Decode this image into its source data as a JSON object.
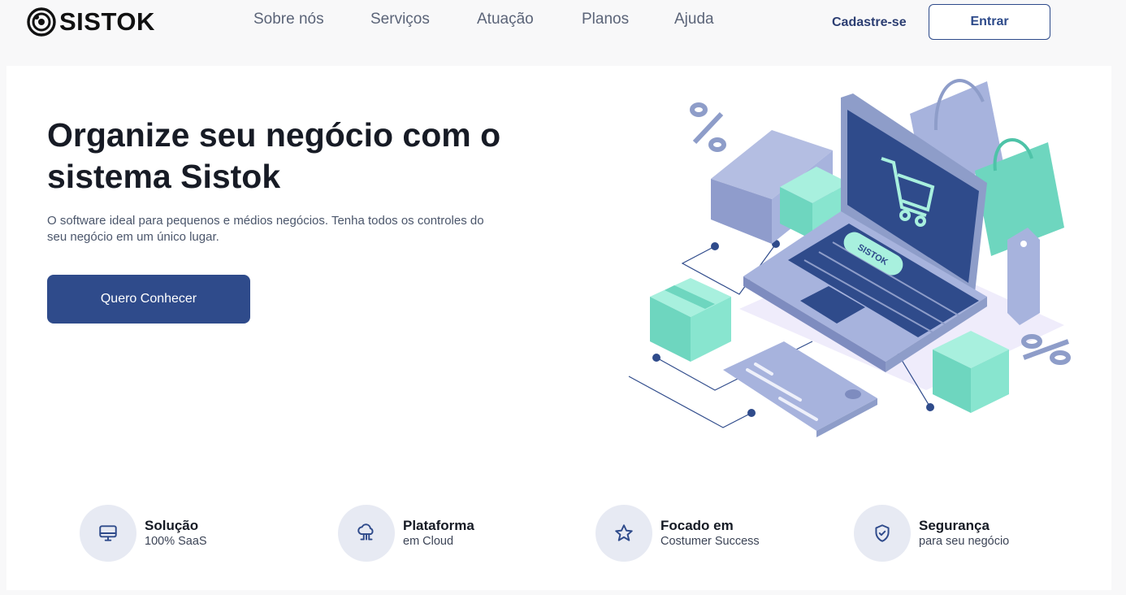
{
  "brand": {
    "name": "SISTOK"
  },
  "nav": {
    "items": [
      {
        "label": "Sobre nós"
      },
      {
        "label": "Serviços"
      },
      {
        "label": "Atuação"
      },
      {
        "label": "Planos"
      },
      {
        "label": "Ajuda"
      }
    ],
    "signup_label": "Cadastre-se",
    "login_label": "Entrar"
  },
  "hero": {
    "title": "Organize seu negócio com o sistema Sistok",
    "subtitle": "O software ideal para pequenos e médios negócios. Tenha todos os controles do seu negócio em um único lugar.",
    "cta_label": "Quero Conhecer",
    "illustration": {
      "laptop_label": "SISTOK",
      "icons": [
        "shopping-cart-icon",
        "percent-icon"
      ]
    }
  },
  "features": [
    {
      "title": "Solução",
      "subtitle": "100% SaaS",
      "icon": "monitor-icon"
    },
    {
      "title": "Plataforma",
      "subtitle": "em Cloud",
      "icon": "cloud-network-icon"
    },
    {
      "title": "Focado em",
      "subtitle": "Costumer Success",
      "icon": "star-icon"
    },
    {
      "title": "Segurança",
      "subtitle": "para seu negócio",
      "icon": "shield-check-icon"
    }
  ],
  "colors": {
    "primary": "#2f4b8b",
    "nav_text": "#5b6478",
    "teal": "#7fe0cc",
    "lavender": "#9aa8d4",
    "icon_bg": "#e7eaf3"
  }
}
